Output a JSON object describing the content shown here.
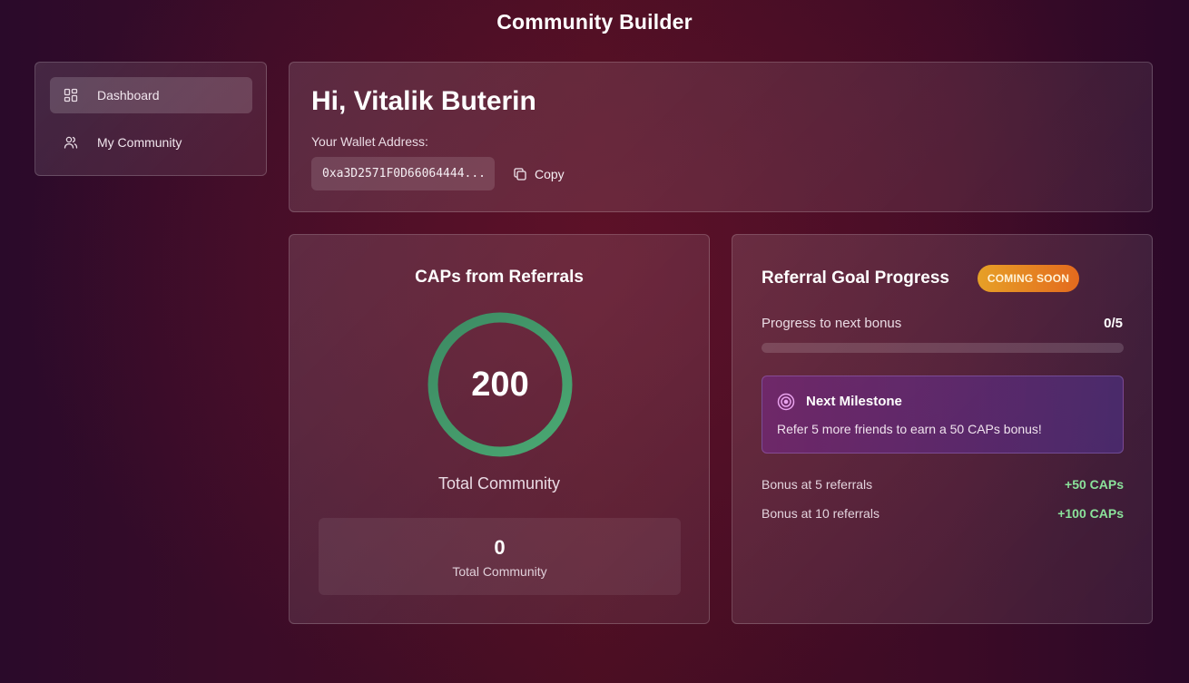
{
  "app": {
    "title": "Community Builder"
  },
  "sidebar": {
    "items": [
      {
        "label": "Dashboard",
        "icon": "dashboard-icon",
        "active": true
      },
      {
        "label": "My Community",
        "icon": "users-icon",
        "active": false
      }
    ]
  },
  "greeting": {
    "title": "Hi, Vitalik Buterin",
    "wallet_label": "Your Wallet Address:",
    "wallet_address": "0xa3D2571F0D66064444...",
    "copy_label": "Copy"
  },
  "caps": {
    "title": "CAPs from Referrals",
    "ring_value": "200",
    "ring_label": "Total Community",
    "stat_value": "0",
    "stat_label": "Total Community"
  },
  "goal": {
    "title": "Referral Goal Progress",
    "badge": "COMING SOON",
    "progress_label": "Progress to next bonus",
    "progress_count": "0/5",
    "progress_fraction": 0,
    "milestone_title": "Next Milestone",
    "milestone_text": "Refer 5 more friends to earn a 50 CAPs bonus!",
    "bonuses": [
      {
        "label": "Bonus at 5 referrals",
        "amount": "+50 CAPs"
      },
      {
        "label": "Bonus at 10 referrals",
        "amount": "+100 CAPs"
      }
    ]
  },
  "colors": {
    "accent_green": "#8be39b",
    "ring_green": "#3f9a66",
    "badge_orange": "#e6a027"
  }
}
